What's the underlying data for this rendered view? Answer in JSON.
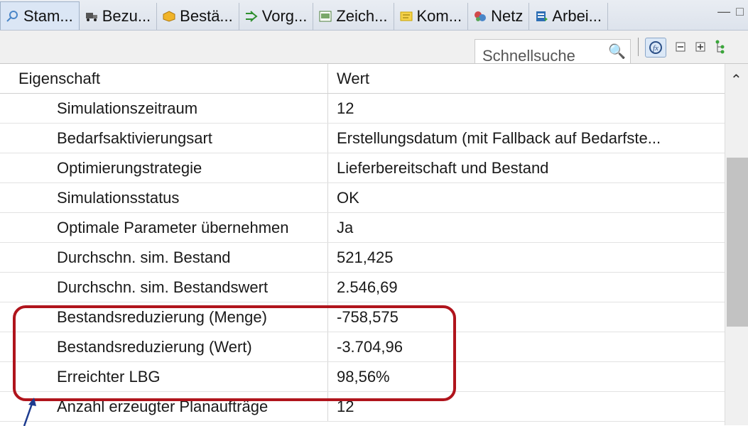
{
  "tabs": [
    {
      "label": "Stam...",
      "icon": "search-icon",
      "icon_color": "#4a86c8",
      "active": true
    },
    {
      "label": "Bezu...",
      "icon": "truck-icon",
      "icon_color": "#333333",
      "active": false
    },
    {
      "label": "Bestä...",
      "icon": "box-icon",
      "icon_color": "#e0a020",
      "active": false
    },
    {
      "label": "Vorg...",
      "icon": "process-icon",
      "icon_color": "#2f8f2f",
      "active": false
    },
    {
      "label": "Zeich...",
      "icon": "drawing-icon",
      "icon_color": "#4b7f3a",
      "active": false
    },
    {
      "label": "Kom...",
      "icon": "comment-icon",
      "icon_color": "#e6b800",
      "active": false
    },
    {
      "label": "Netz",
      "icon": "network-icon",
      "icon_color": "#c73a3a",
      "active": false
    },
    {
      "label": "Arbei...",
      "icon": "worklist-icon",
      "icon_color": "#2e6fb5",
      "active": false
    }
  ],
  "toolbar": {
    "search_placeholder": "Schnellsuche",
    "buttons": [
      "formula-icon",
      "collapse-all-icon",
      "expand-all-icon",
      "tree-icon"
    ]
  },
  "table": {
    "header": {
      "property": "Eigenschaft",
      "value": "Wert"
    },
    "rows": [
      {
        "property": "Simulationszeitraum",
        "value": "12"
      },
      {
        "property": "Bedarfsaktivierungsart",
        "value": "Erstellungsdatum (mit Fallback auf Bedarfste..."
      },
      {
        "property": "Optimierungstrategie",
        "value": "Lieferbereitschaft und Bestand"
      },
      {
        "property": "Simulationsstatus",
        "value": "OK"
      },
      {
        "property": "Optimale Parameter übernehmen",
        "value": "Ja"
      },
      {
        "property": "Durchschn. sim. Bestand",
        "value": "521,425"
      },
      {
        "property": "Durchschn. sim. Bestandswert",
        "value": "2.546,69"
      },
      {
        "property": "Bestandsreduzierung (Menge)",
        "value": "-758,575"
      },
      {
        "property": "Bestandsreduzierung (Wert)",
        "value": "-3.704,96"
      },
      {
        "property": "Erreichter LBG",
        "value": "98,56%"
      },
      {
        "property": "Anzahl erzeugter Planaufträge",
        "value": "12"
      }
    ]
  },
  "colors": {
    "highlight": "#b0141c",
    "arrow": "#1d3b8f"
  }
}
